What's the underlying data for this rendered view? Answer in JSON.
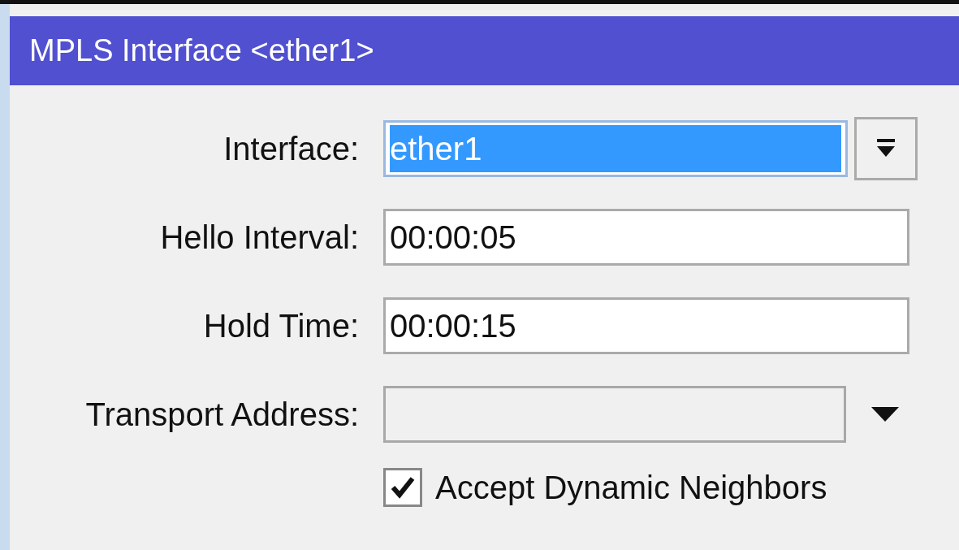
{
  "window": {
    "title": "MPLS Interface <ether1>"
  },
  "fields": [
    {
      "kind": "dropdown",
      "label": "Interface:",
      "value": "ether1",
      "selected": true,
      "disabled": false
    },
    {
      "kind": "text",
      "label": "Hello Interval:",
      "value": "00:00:05",
      "selected": false,
      "disabled": false
    },
    {
      "kind": "text",
      "label": "Hold Time:",
      "value": "00:00:15",
      "selected": false,
      "disabled": false
    },
    {
      "kind": "combo",
      "label": "Transport Address:",
      "selected": false,
      "disabled": true
    }
  ],
  "checkbox": {
    "label": "Accept Dynamic Neighbors",
    "checked": true
  }
}
